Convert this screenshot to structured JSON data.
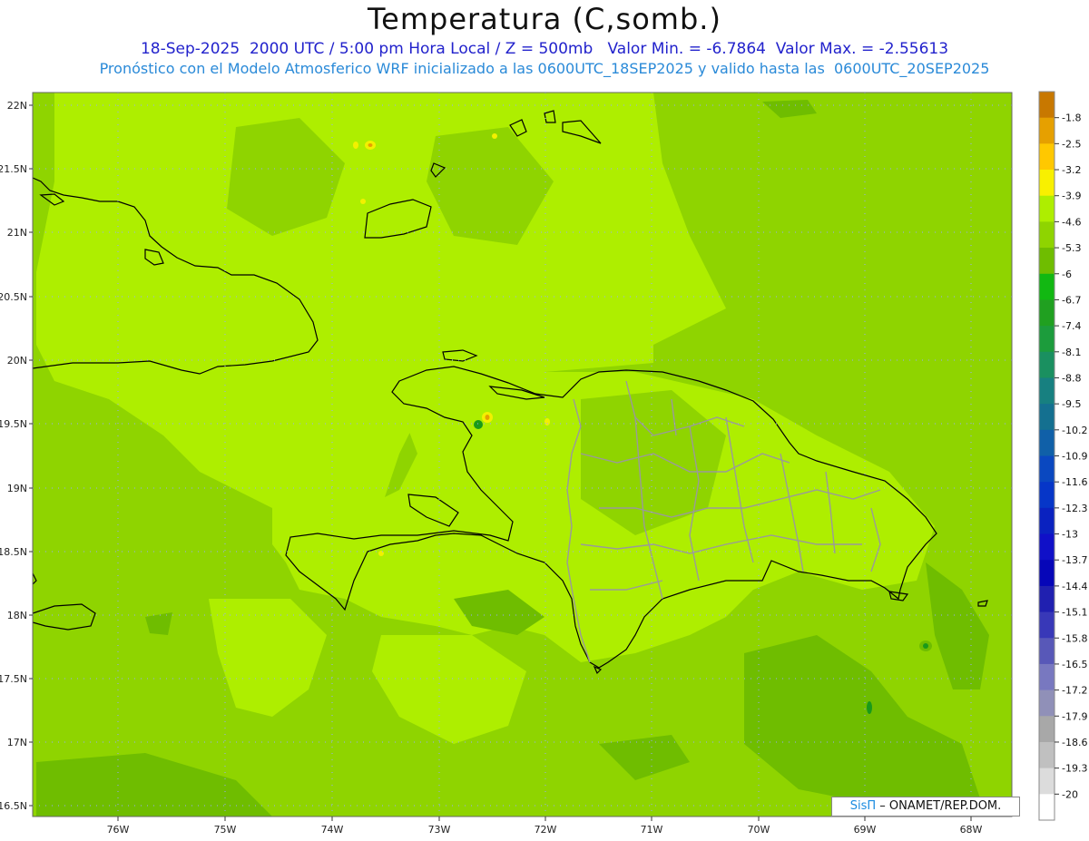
{
  "header": {
    "title": "Temperatura (C,somb.)",
    "line1": "18-Sep-2025  2000 UTC / 5:00 pm Hora Local / Z = 500mb   Valor Min. = -6.7864  Valor Max. = -2.55613",
    "line2": "Pronóstico con el Modelo Atmosferico WRF inicializado a las 0600UTC_18SEP2025 y valido hasta las  0600UTC_20SEP2025"
  },
  "map": {
    "lat_labels": [
      "22N",
      "21.5N",
      "21N",
      "20.5N",
      "20N",
      "19.5N",
      "19N",
      "18.5N",
      "18N",
      "17.5N",
      "17N",
      "16.5N"
    ],
    "lon_labels": [
      "76W",
      "75W",
      "74W",
      "73W",
      "72W",
      "71W",
      "70W",
      "69W",
      "68W"
    ],
    "field_colors": {
      "base": "#8fd400",
      "light": "#aeee00",
      "dark": "#6fbd00",
      "yellow": "#f2f000",
      "orange": "#e6a000",
      "green": "#1a9a1a"
    }
  },
  "colorbar": {
    "labels": [
      "-1.8",
      "-2.5",
      "-3.2",
      "-3.9",
      "-4.6",
      "-5.3",
      "-6",
      "-6.7",
      "-7.4",
      "-8.1",
      "-8.8",
      "-9.5",
      "-10.2",
      "-10.9",
      "-11.6",
      "-12.3",
      "-13",
      "-13.7",
      "-14.4",
      "-15.1",
      "-15.8",
      "-16.5",
      "-17.2",
      "-17.9",
      "-18.6",
      "-19.3",
      "-20"
    ],
    "colors": [
      "#c87800",
      "#e6a000",
      "#ffc800",
      "#f8f000",
      "#aeee00",
      "#8fd400",
      "#6fbd00",
      "#12b812",
      "#20a020",
      "#1c9c3c",
      "#1a9060",
      "#178080",
      "#147090",
      "#1060a8",
      "#0a48c0",
      "#0636c8",
      "#0a22c0",
      "#1010c8",
      "#0606b8",
      "#2020b0",
      "#3838b8",
      "#5858b8",
      "#7878c0",
      "#9090b8",
      "#a8a8a8",
      "#c0c0c0",
      "#dcdcdc",
      "#ffffff"
    ]
  },
  "credit": {
    "brand": "SisΠ",
    "text": "– ONAMET/REP.DOM."
  }
}
